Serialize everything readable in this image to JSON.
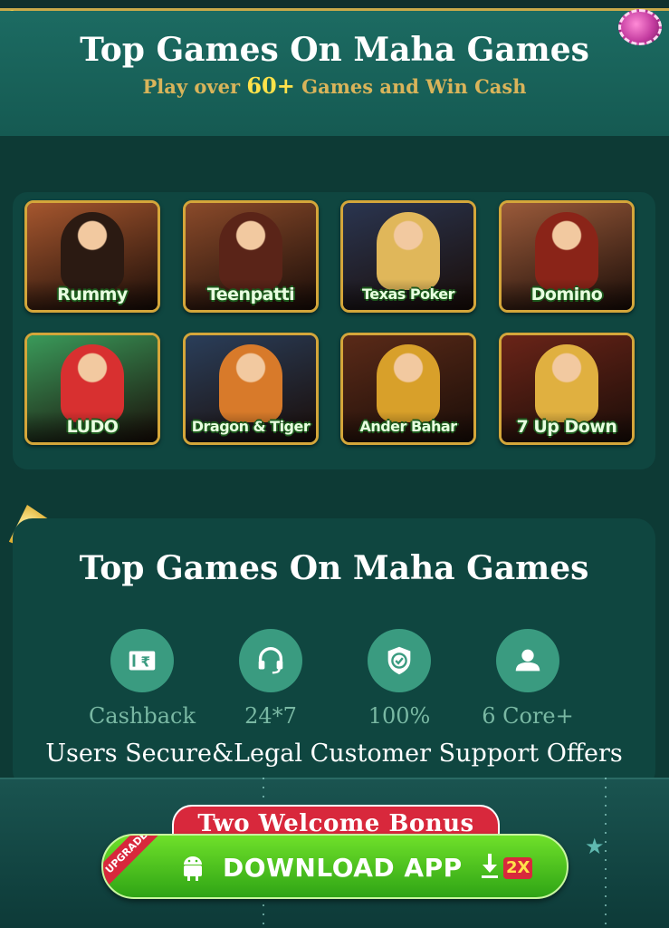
{
  "header": {
    "title": "Top Games On Maha Games",
    "subtitle_prefix": "Play over ",
    "subtitle_highlight": "60+",
    "subtitle_suffix": " Games and Win Cash"
  },
  "games": [
    {
      "label": "Rummy",
      "icon": "rummy-game-icon",
      "bg": "#a5562e",
      "fig": "#2b1a12"
    },
    {
      "label": "Teenpatti",
      "icon": "teenpatti-game-icon",
      "bg": "#8a4a2a",
      "fig": "#5a2418"
    },
    {
      "label": "Texas Poker",
      "icon": "texas-poker-game-icon",
      "bg": "#2a3550",
      "fig": "#e0b75a"
    },
    {
      "label": "Domino",
      "icon": "domino-game-icon",
      "bg": "#9a5a3a",
      "fig": "#8a2418"
    },
    {
      "label": "LUDO",
      "icon": "ludo-game-icon",
      "bg": "#3a9a5a",
      "fig": "#d83030"
    },
    {
      "label": "Dragon & Tiger",
      "icon": "dragon-tiger-game-icon",
      "bg": "#2a3e5a",
      "fig": "#d87a2a"
    },
    {
      "label": "Ander Bahar",
      "icon": "ander-bahar-game-icon",
      "bg": "#5a2a18",
      "fig": "#d8a02a"
    },
    {
      "label": "7 Up Down",
      "icon": "seven-up-down-game-icon",
      "bg": "#6a2418",
      "fig": "#e0b040"
    }
  ],
  "features": {
    "title": "Top Games On Maha Games",
    "items": [
      {
        "value": "Cashback",
        "icon": "rupee-ticket-icon"
      },
      {
        "value": "24*7",
        "icon": "headset-icon"
      },
      {
        "value": "100%",
        "icon": "shield-check-icon"
      },
      {
        "value": "6 Core+",
        "icon": "users-icon"
      }
    ],
    "description": "Users Secure&Legal Customer Support Offers"
  },
  "bottom": {
    "bonus_label": "Two Welcome Bonus",
    "upgrade_badge": "UPGRADE",
    "download_label": "DOWNLOAD APP",
    "multiplier": "2X"
  },
  "colors": {
    "background": "#0d3a35",
    "header": "#1c6b62",
    "accent_gold": "#d9b45a",
    "button_green": "#3fbf1f",
    "bonus_red": "#d8283c"
  }
}
